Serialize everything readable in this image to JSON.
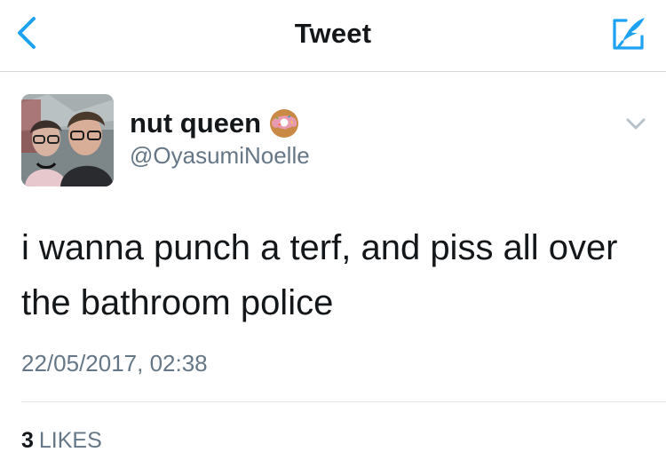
{
  "header": {
    "title": "Tweet",
    "back_icon": "chevron-left-icon",
    "compose_icon": "compose-tweet-icon",
    "accent_color": "#1da1f2"
  },
  "tweet": {
    "author": {
      "name": "nut queen",
      "name_emoji": "donut",
      "handle": "@OyasumiNoelle"
    },
    "text": "i wanna punch a terf, and piss all over the bathroom police",
    "timestamp": "22/05/2017, 02:38",
    "likes": {
      "count": "3",
      "label": "LIKES"
    }
  }
}
